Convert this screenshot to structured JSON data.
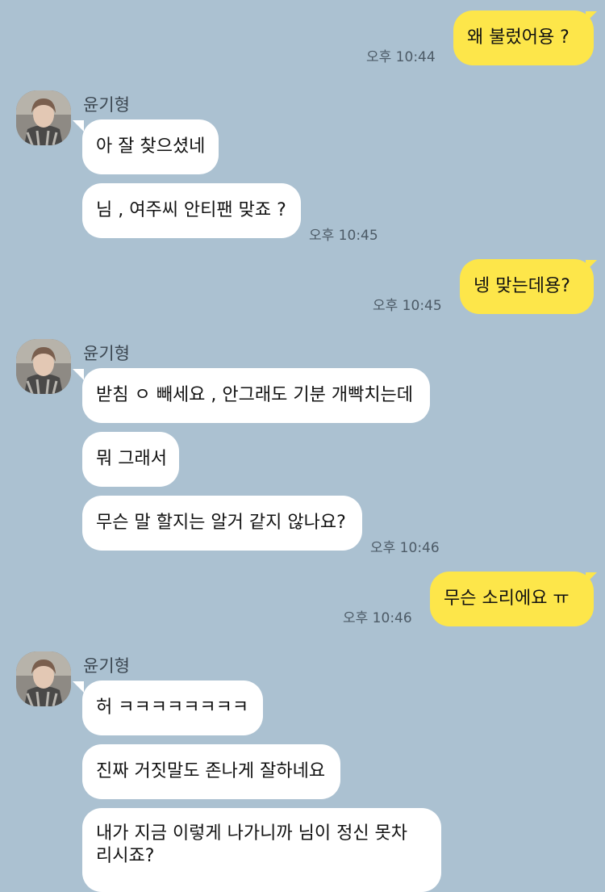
{
  "contact": {
    "name": "윤기형"
  },
  "messages": {
    "m1": {
      "text": "왜 불렀어용 ?",
      "time": "오후 10:44"
    },
    "m2": {
      "text": "아 잘 찾으셨네"
    },
    "m3": {
      "text": "님 , 여주씨 안티팬 맞죠 ?",
      "time": "오후 10:45"
    },
    "m4": {
      "text": "넹 맞는데용?",
      "time": "오후 10:45"
    },
    "m5": {
      "text": "받침 ㅇ 빼세요 , 안그래도 기분 개빡치는데"
    },
    "m6": {
      "text": "뭐 그래서"
    },
    "m7": {
      "text": "무슨 말 할지는 알거 같지 않나요?",
      "time": "오후 10:46"
    },
    "m8": {
      "text": "무슨 소리에요 ㅠ",
      "time": "오후 10:46"
    },
    "m9": {
      "text": "허 ㅋㅋㅋㅋㅋㅋㅋㅋ"
    },
    "m10": {
      "text": "진짜 거짓말도 존나게 잘하네요"
    },
    "m11": {
      "line1": "내가 지금 이렇게 나가니까 님이 정신 못차",
      "line2": "리시죠?"
    }
  }
}
